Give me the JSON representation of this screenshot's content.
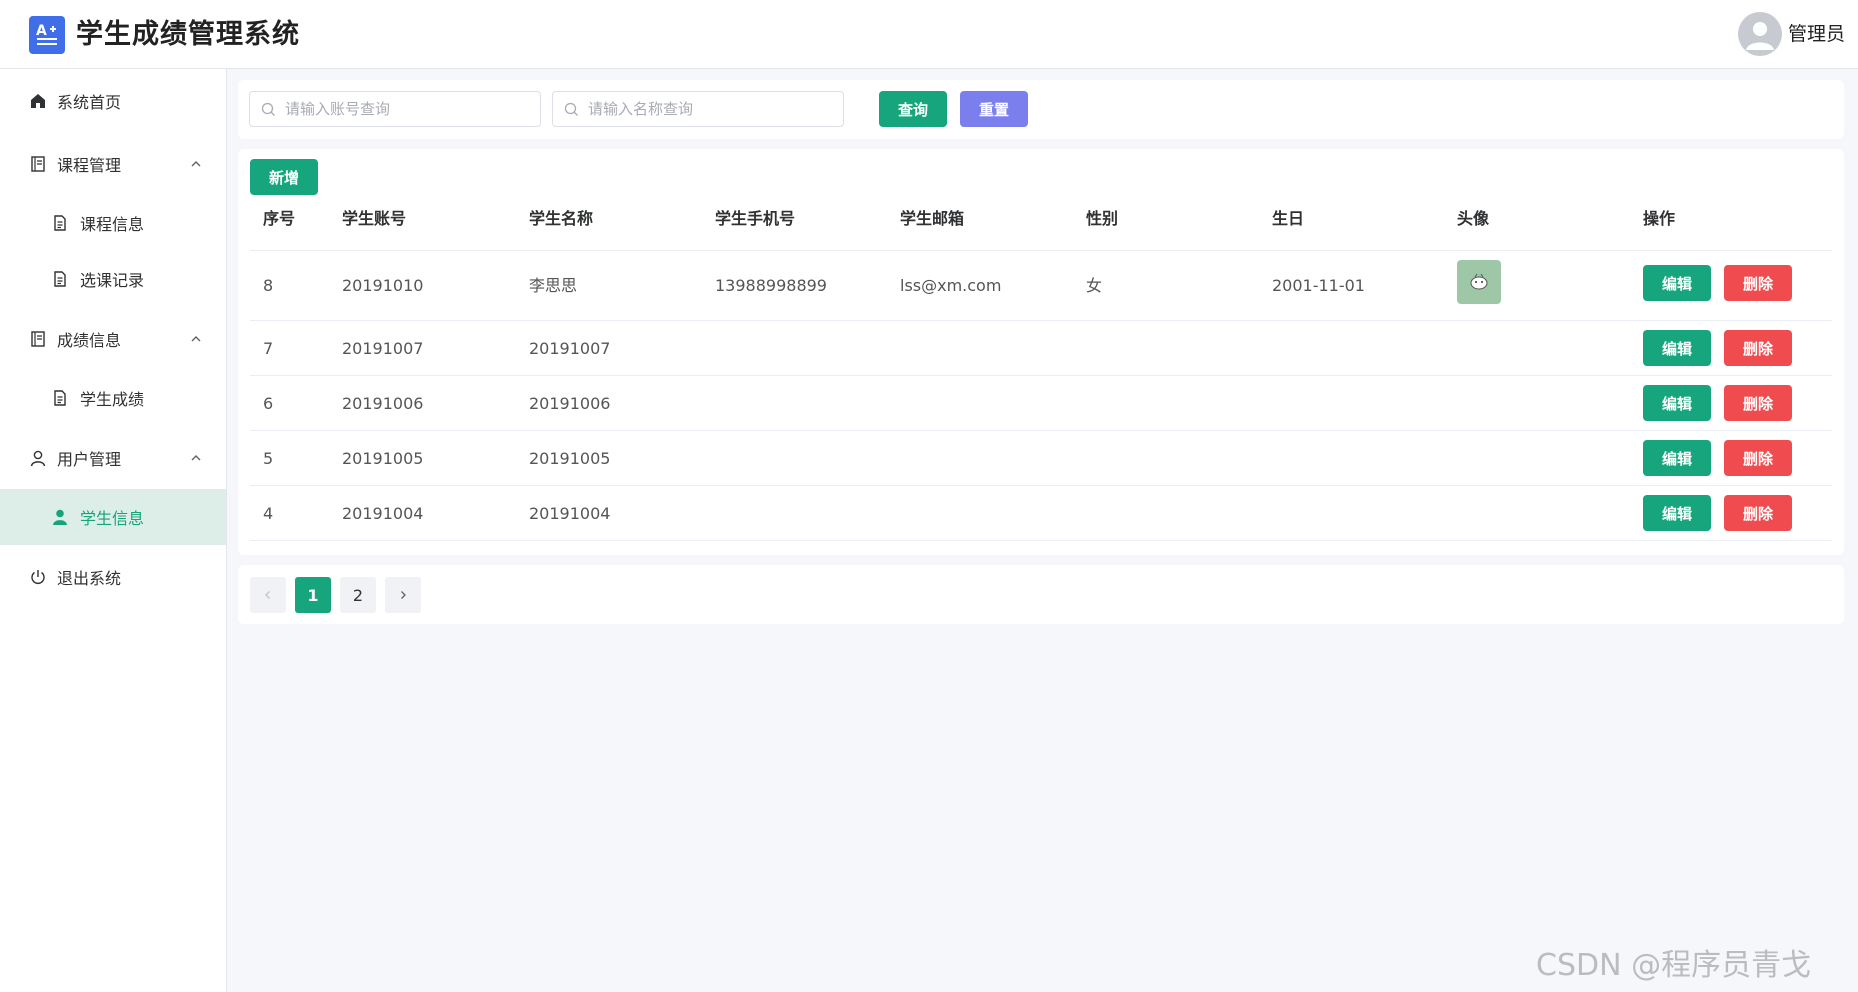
{
  "header": {
    "logo_icon": "grade-a-plus-icon",
    "title": "学生成绩管理系统",
    "user_name": "管理员"
  },
  "sidebar": {
    "items": [
      {
        "label": "系统首页",
        "icon": "home-icon"
      },
      {
        "label": "课程管理",
        "icon": "book-icon",
        "expanded": true
      },
      {
        "label": "课程信息",
        "icon": "document-icon"
      },
      {
        "label": "选课记录",
        "icon": "document-icon"
      },
      {
        "label": "成绩信息",
        "icon": "book-icon",
        "expanded": true
      },
      {
        "label": "学生成绩",
        "icon": "document-icon"
      },
      {
        "label": "用户管理",
        "icon": "user-icon",
        "expanded": true
      },
      {
        "label": "学生信息",
        "icon": "user-icon",
        "active": true
      },
      {
        "label": "退出系统",
        "icon": "power-icon"
      }
    ]
  },
  "search": {
    "account_placeholder": "请输入账号查询",
    "name_placeholder": "请输入名称查询",
    "query_label": "查询",
    "reset_label": "重置"
  },
  "table": {
    "add_label": "新增",
    "columns": [
      "序号",
      "学生账号",
      "学生名称",
      "学生手机号",
      "学生邮箱",
      "性别",
      "生日",
      "头像",
      "操作"
    ],
    "rows": [
      {
        "id": "8",
        "account": "20191010",
        "name": "李思思",
        "phone": "13988998899",
        "email": "lss@xm.com",
        "gender": "女",
        "birthday": "2001-11-01",
        "has_avatar": true
      },
      {
        "id": "7",
        "account": "20191007",
        "name": "20191007",
        "phone": "",
        "email": "",
        "gender": "",
        "birthday": "",
        "has_avatar": false
      },
      {
        "id": "6",
        "account": "20191006",
        "name": "20191006",
        "phone": "",
        "email": "",
        "gender": "",
        "birthday": "",
        "has_avatar": false
      },
      {
        "id": "5",
        "account": "20191005",
        "name": "20191005",
        "phone": "",
        "email": "",
        "gender": "",
        "birthday": "",
        "has_avatar": false
      },
      {
        "id": "4",
        "account": "20191004",
        "name": "20191004",
        "phone": "",
        "email": "",
        "gender": "",
        "birthday": "",
        "has_avatar": false
      }
    ],
    "edit_label": "编辑",
    "delete_label": "删除"
  },
  "pagination": {
    "pages": [
      "1",
      "2"
    ],
    "current": "1"
  },
  "watermark": "CSDN @程序员青戈",
  "colors": {
    "primary": "#17a57d",
    "reset": "#7b7fee",
    "danger": "#f04c4f",
    "logo": "#3f6ee8",
    "active_bg": "#ddeee8"
  }
}
